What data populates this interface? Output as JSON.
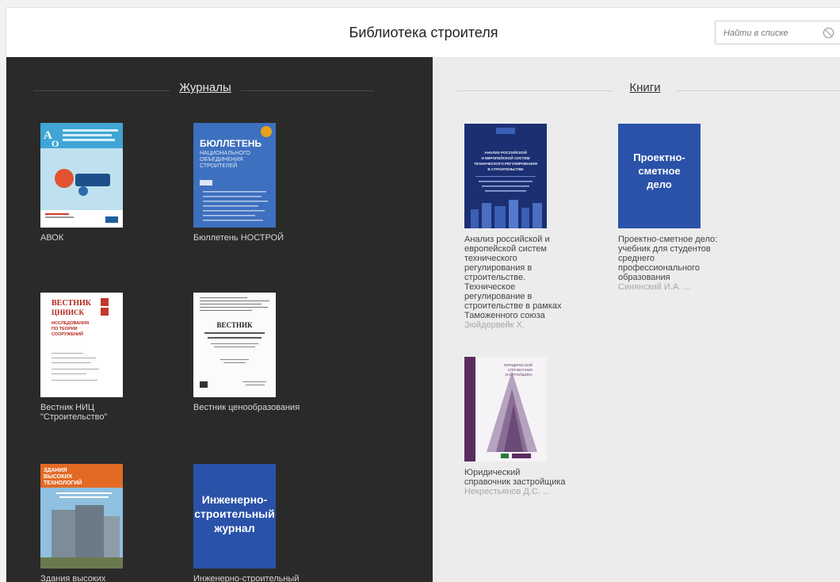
{
  "header": {
    "title": "Библиотека строителя",
    "search_placeholder": "Найти в списке"
  },
  "journals": {
    "title": "Журналы",
    "items": [
      {
        "title": "АВОК"
      },
      {
        "title": "Бюллетень НОСТРОЙ"
      },
      {
        "title": "Вестник НИЦ \"Строительство\""
      },
      {
        "title": "Вестник ценообразования"
      },
      {
        "title": "Здания высоких технологий"
      },
      {
        "title": "Инженерно-строительный журнал"
      }
    ],
    "cover_texts": {
      "nostroy_main": "БЮЛЛЕТЕНЬ",
      "nostroy_sub1": "НАЦИОНАЛЬНОГО",
      "nostroy_sub2": "ОБЪЕДИНЕНИЯ",
      "nostroy_sub3": "СТРОИТЕЛЕЙ",
      "vestnik_nic_1": "ВЕСТНИК",
      "vestnik_nic_2": "ЦНИИСК",
      "vestnik_nic_3": "ИССЛЕДОВАНИЯ",
      "vestnik_nic_4": "ПО ТЕОРИИ",
      "vestnik_nic_5": "СООРУЖЕНИЙ",
      "vestnik_price": "ВЕСТНИК",
      "zvt_1": "ЗДАНИЯ",
      "zvt_2": "ВЫСОКИХ",
      "zvt_3": "ТЕХНОЛОГИЙ",
      "isj_1": "Инженерно-",
      "isj_2": "строительный",
      "isj_3": "журнал"
    }
  },
  "books": {
    "title": "Книги",
    "items": [
      {
        "title": "Анализ российской и европейской систем технического регулирования в строительстве. Техническое регулирование в строительстве в рамках Таможенного союза",
        "author": "Зюйдервейк Х."
      },
      {
        "title": "Проектно-сметное дело: учебник для студентов среднего профессионального образования",
        "author": "Синянский И.А. ..."
      },
      {
        "title": "Юридический справочник застройщика",
        "author": "Некрестьянов Д.С. ..."
      }
    ],
    "cover_texts": {
      "analysis_1": "АНАЛИЗ РОССИЙСКОЙ",
      "analysis_2": "И ЕВРОПЕЙСКОЙ СИСТЕМ",
      "analysis_3": "ТЕХНИЧЕСКОГО РЕГУЛИРОВАНИЯ",
      "analysis_4": "В СТРОИТЕЛЬСТВЕ",
      "psd_1": "Проектно-",
      "psd_2": "сметное",
      "psd_3": "дело",
      "legal_1": "ЮРИДИЧЕСКИЙ",
      "legal_2": "СПРАВОЧНИК",
      "legal_3": "ЗАСТРОЙЩИКА"
    }
  },
  "colors": {
    "journals_bg": "#2b2a2a",
    "books_bg": "#ececec",
    "cover_blue": "#2a52a8",
    "cover_navy": "#1c2f73"
  }
}
